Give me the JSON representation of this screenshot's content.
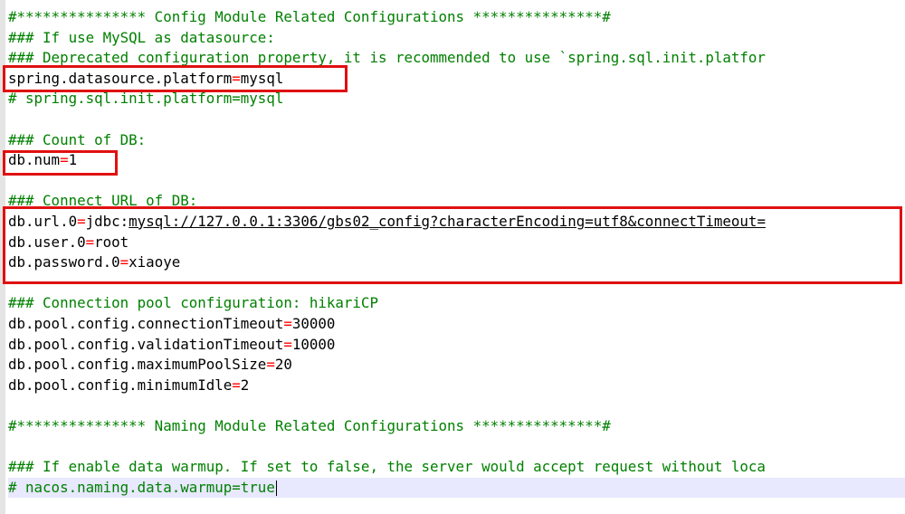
{
  "editor": {
    "lines": [
      {
        "kind": "comment",
        "text": "#*************** Config Module Related Configurations ***************#"
      },
      {
        "kind": "comment",
        "text": "### If use MySQL as datasource:"
      },
      {
        "kind": "comment",
        "text": "### Deprecated configuration property, it is recommended to use `spring.sql.init.platfor"
      },
      {
        "kind": "prop",
        "key": "spring.datasource.platform",
        "eq": "=",
        "value": "mysql"
      },
      {
        "kind": "comment",
        "text": "# spring.sql.init.platform=mysql"
      },
      {
        "kind": "blank",
        "text": ""
      },
      {
        "kind": "comment",
        "text": "### Count of DB:"
      },
      {
        "kind": "prop",
        "key": "db.num",
        "eq": "=",
        "value": "1"
      },
      {
        "kind": "blank",
        "text": ""
      },
      {
        "kind": "comment",
        "text": "### Connect URL of DB:"
      },
      {
        "kind": "prop",
        "key": "db.url.0",
        "eq": "=",
        "value_pre": "jdbc:",
        "value_link": "mysql://127.0.0.1:3306/gbs02_config?characterEncoding=utf8&connectTimeout="
      },
      {
        "kind": "prop",
        "key": "db.user.0",
        "eq": "=",
        "value": "root"
      },
      {
        "kind": "prop",
        "key": "db.password.0",
        "eq": "=",
        "value": "xiaoye"
      },
      {
        "kind": "blank",
        "text": ""
      },
      {
        "kind": "comment",
        "text": "### Connection pool configuration: hikariCP"
      },
      {
        "kind": "prop",
        "key": "db.pool.config.connectionTimeout",
        "eq": "=",
        "value": "30000"
      },
      {
        "kind": "prop",
        "key": "db.pool.config.validationTimeout",
        "eq": "=",
        "value": "10000"
      },
      {
        "kind": "prop",
        "key": "db.pool.config.maximumPoolSize",
        "eq": "=",
        "value": "20"
      },
      {
        "kind": "prop",
        "key": "db.pool.config.minimumIdle",
        "eq": "=",
        "value": "2"
      },
      {
        "kind": "blank",
        "text": ""
      },
      {
        "kind": "comment",
        "text": "#*************** Naming Module Related Configurations ***************#"
      },
      {
        "kind": "blank",
        "text": ""
      },
      {
        "kind": "comment",
        "text": "### If enable data warmup. If set to false, the server would accept request without loca"
      },
      {
        "kind": "comment",
        "text": "# nacos.naming.data.warmup=true",
        "current": true
      }
    ]
  },
  "colors": {
    "comment": "#008000",
    "key": "#000000",
    "operator": "#ff0000",
    "highlight_box": "#e01010",
    "current_line": "#e8e8ff"
  }
}
